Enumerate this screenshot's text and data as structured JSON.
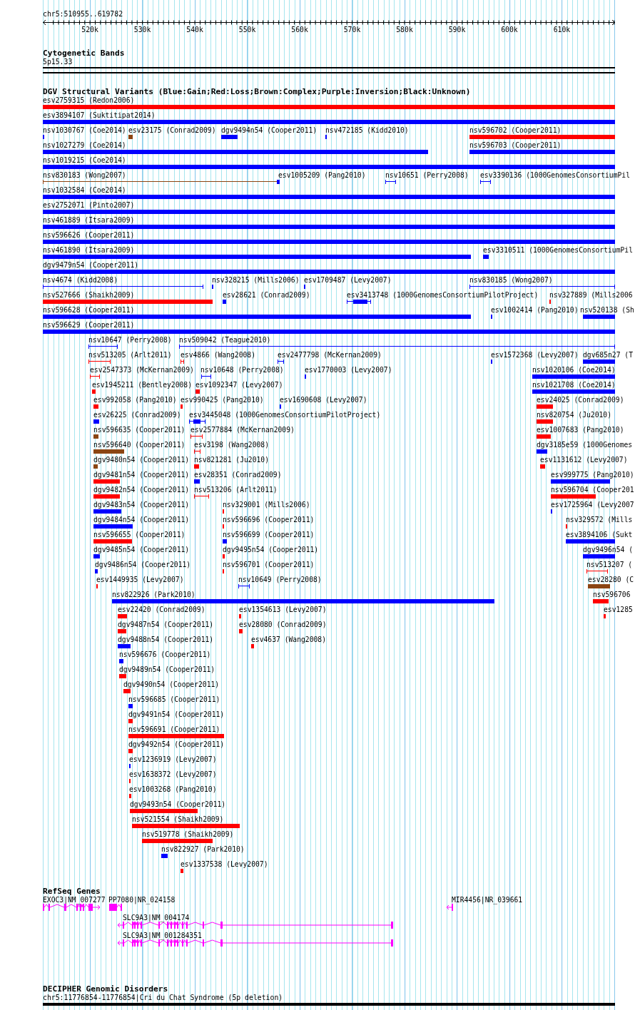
{
  "ruler": {
    "location": "chr5:510955..619782",
    "ticks": [
      "520k",
      "530k",
      "540k",
      "550k",
      "560k",
      "570k",
      "580k",
      "590k",
      "600k",
      "610k"
    ]
  },
  "cytogenetic_bands": {
    "title": "Cytogenetic Bands",
    "band": "5p15.33"
  },
  "dgv": {
    "title": "DGV Structural Variants (Blue:Gain;Red:Loss;Brown:Complex;Purple:Inversion;Black:Unknown)",
    "rows": [
      {
        "features": [
          {
            "label": "esv2759315 (Redon2006)",
            "color": "#ff0000",
            "kind": "bar"
          }
        ]
      },
      {
        "features": [
          {
            "label": "esv3894107 (Suktitipat2014)",
            "color": "#0000ff",
            "kind": "bar"
          }
        ]
      },
      {
        "features": [
          {
            "label": "nsv1030767 (Coe2014)",
            "color": "#0000ff",
            "kind": "bar"
          },
          {
            "label": "esv23175 (Conrad2009)",
            "color": "#8b4513",
            "kind": "bar"
          },
          {
            "label": "dgv9494n54 (Cooper2011)",
            "color": "#0000ff",
            "kind": "bar"
          },
          {
            "label": "nsv472185 (Kidd2010)",
            "color": "#0000ff",
            "kind": "bar"
          },
          {
            "label": "nsv596702 (Cooper2011)",
            "color": "#ff0000",
            "kind": "bar"
          }
        ]
      },
      {
        "features": [
          {
            "label": "nsv1027279 (Coe2014)",
            "color": "#0000ff",
            "kind": "bar"
          },
          {
            "label": "nsv596703 (Cooper2011)",
            "color": "#0000ff",
            "kind": "bar"
          }
        ]
      },
      {
        "features": [
          {
            "label": "nsv1019215 (Coe2014)",
            "color": "#0000ff",
            "kind": "bar"
          }
        ]
      },
      {
        "features": [
          {
            "label": "nsv830183 (Wong2007)",
            "color": "#8b4513",
            "kind": "span"
          },
          {
            "label": "esv1005209 (Pang2010)",
            "color": "#0000ff",
            "kind": "bar"
          },
          {
            "label": "nsv10651 (Perry2008)",
            "color": "#0000ff",
            "kind": "span"
          },
          {
            "label": "esv3390136 (1000GenomesConsortiumPil",
            "color": "#0000ff",
            "kind": "span"
          }
        ]
      },
      {
        "features": [
          {
            "label": "nsv1032584 (Coe2014)",
            "color": "#0000ff",
            "kind": "bar"
          }
        ]
      },
      {
        "features": [
          {
            "label": "esv2752071 (Pinto2007)",
            "color": "#0000ff",
            "kind": "bar"
          }
        ]
      },
      {
        "features": [
          {
            "label": "nsv461889 (Itsara2009)",
            "color": "#0000ff",
            "kind": "bar"
          }
        ]
      },
      {
        "features": [
          {
            "label": "nsv596626 (Cooper2011)",
            "color": "#0000ff",
            "kind": "bar"
          }
        ]
      },
      {
        "features": [
          {
            "label": "nsv461890 (Itsara2009)",
            "color": "#0000ff",
            "kind": "bar"
          },
          {
            "label": "esv3310511 (1000GenomesConsortiumPil",
            "color": "#0000ff",
            "kind": "bar"
          }
        ]
      },
      {
        "features": [
          {
            "label": "dgv9479n54 (Cooper2011)",
            "color": "#0000ff",
            "kind": "bar"
          }
        ]
      },
      {
        "features": [
          {
            "label": "nsv4674 (Kidd2008)",
            "color": "#0000ff",
            "kind": "span"
          },
          {
            "label": "nsv328215 (Mills2006)",
            "color": "#0000ff",
            "kind": "bar"
          },
          {
            "label": "esv1709487 (Levy2007)",
            "color": "#0000ff",
            "kind": "bar"
          },
          {
            "label": "nsv830185 (Wong2007)",
            "color": "#0000ff",
            "kind": "span"
          }
        ]
      },
      {
        "features": [
          {
            "label": "nsv527666 (Shaikh2009)",
            "color": "#ff0000",
            "kind": "bar"
          },
          {
            "label": "esv28621 (Conrad2009)",
            "color": "#0000ff",
            "kind": "bar"
          },
          {
            "label": "esv3413748 (1000GenomesConsortiumPilotProject)",
            "color": "#0000ff",
            "kind": "span_core"
          },
          {
            "label": "nsv327889 (Mills2006",
            "color": "#ff0000",
            "kind": "bar"
          }
        ]
      },
      {
        "features": [
          {
            "label": "nsv596628 (Cooper2011)",
            "color": "#0000ff",
            "kind": "bar"
          },
          {
            "label": "esv1002414 (Pang2010)",
            "color": "#0000ff",
            "kind": "bar"
          },
          {
            "label": "nsv520138 (Sh",
            "color": "#0000ff",
            "kind": "bar"
          }
        ]
      },
      {
        "features": [
          {
            "label": "nsv596629 (Cooper2011)",
            "color": "#0000ff",
            "kind": "bar"
          }
        ]
      },
      {
        "features": [
          {
            "label": "nsv10647 (Perry2008)",
            "color": "#0000ff",
            "kind": "span"
          },
          {
            "label": "nsv509042 (Teague2010)",
            "color": "#0000ff",
            "kind": "span"
          }
        ]
      },
      {
        "features": [
          {
            "label": "nsv513205 (Arlt2011)",
            "color": "#ff0000",
            "kind": "span"
          },
          {
            "label": "esv4866 (Wang2008)",
            "color": "#ff0000",
            "kind": "span"
          },
          {
            "label": "esv2477798 (McKernan2009)",
            "color": "#0000ff",
            "kind": "span"
          },
          {
            "label": "esv1572368 (Levy2007)",
            "color": "#0000ff",
            "kind": "bar"
          },
          {
            "label": "dgv685n27 (T",
            "color": "#0000ff",
            "kind": "bar"
          }
        ]
      },
      {
        "features": [
          {
            "label": "esv2547373 (McKernan2009)",
            "color": "#ff0000",
            "kind": "span"
          },
          {
            "label": "nsv10648 (Perry2008)",
            "color": "#0000ff",
            "kind": "span"
          },
          {
            "label": "esv1770003 (Levy2007)",
            "color": "#0000ff",
            "kind": "bar"
          },
          {
            "label": "nsv1020106 (Coe2014)",
            "color": "#0000ff",
            "kind": "bar"
          }
        ]
      },
      {
        "features": [
          {
            "label": "esv1945211 (Bentley2008)",
            "color": "#ff0000",
            "kind": "bar"
          },
          {
            "label": "esv1092347 (Levy2007)",
            "color": "#ff0000",
            "kind": "bar"
          },
          {
            "label": "nsv1021708 (Coe2014)",
            "color": "#0000ff",
            "kind": "bar"
          }
        ]
      },
      {
        "features": [
          {
            "label": "esv992058 (Pang2010)",
            "color": "#ff0000",
            "kind": "bar"
          },
          {
            "label": "esv990425 (Pang2010)",
            "color": "#ff0000",
            "kind": "bar"
          },
          {
            "label": "esv1690608 (Levy2007)",
            "color": "#0000ff",
            "kind": "bar"
          },
          {
            "label": "esv24025 (Conrad2009)",
            "color": "#ff0000",
            "kind": "bar"
          }
        ]
      },
      {
        "features": [
          {
            "label": "esv26225 (Conrad2009)",
            "color": "#0000ff",
            "kind": "bar"
          },
          {
            "label": "esv3445048 (1000GenomesConsortiumPilotProject)",
            "color": "#0000ff",
            "kind": "span_core"
          },
          {
            "label": "nsv820754 (Ju2010)",
            "color": "#ff0000",
            "kind": "bar"
          }
        ]
      },
      {
        "features": [
          {
            "label": "nsv596635 (Cooper2011)",
            "color": "#8b4513",
            "kind": "bar"
          },
          {
            "label": "esv2577884 (McKernan2009)",
            "color": "#ff0000",
            "kind": "span"
          },
          {
            "label": "esv1007683 (Pang2010)",
            "color": "#ff0000",
            "kind": "bar"
          }
        ]
      },
      {
        "features": [
          {
            "label": "nsv596640 (Cooper2011)",
            "color": "#8b4513",
            "kind": "bar"
          },
          {
            "label": "esv3198 (Wang2008)",
            "color": "#ff0000",
            "kind": "span"
          },
          {
            "label": "dgv3185e59 (1000Genomes",
            "color": "#0000ff",
            "kind": "bar"
          }
        ]
      },
      {
        "features": [
          {
            "label": "dgv9480n54 (Cooper2011)",
            "color": "#8b4513",
            "kind": "bar"
          },
          {
            "label": "nsv821281 (Ju2010)",
            "color": "#ff0000",
            "kind": "bar"
          },
          {
            "label": "esv1131612 (Levy2007)",
            "color": "#ff0000",
            "kind": "bar"
          }
        ]
      },
      {
        "features": [
          {
            "label": "dgv9481n54 (Cooper2011)",
            "color": "#ff0000",
            "kind": "bar"
          },
          {
            "label": "esv28351 (Conrad2009)",
            "color": "#0000ff",
            "kind": "bar"
          },
          {
            "label": "esv999775 (Pang2010)",
            "color": "#0000ff",
            "kind": "bar"
          }
        ]
      },
      {
        "features": [
          {
            "label": "dgv9482n54 (Cooper2011)",
            "color": "#ff0000",
            "kind": "bar"
          },
          {
            "label": "nsv513206 (Arlt2011)",
            "color": "#ff0000",
            "kind": "span"
          },
          {
            "label": "nsv596704 (Cooper201",
            "color": "#ff0000",
            "kind": "bar"
          }
        ]
      },
      {
        "features": [
          {
            "label": "dgv9483n54 (Cooper2011)",
            "color": "#0000ff",
            "kind": "bar"
          },
          {
            "label": "nsv329001 (Mills2006)",
            "color": "#ff0000",
            "kind": "bar"
          },
          {
            "label": "esv1725964 (Levy2007",
            "color": "#0000ff",
            "kind": "bar"
          }
        ]
      },
      {
        "features": [
          {
            "label": "dgv9484n54 (Cooper2011)",
            "color": "#0000ff",
            "kind": "bar"
          },
          {
            "label": "nsv596696 (Cooper2011)",
            "color": "#ff0000",
            "kind": "bar"
          },
          {
            "label": "nsv329572 (Mills",
            "color": "#ff0000",
            "kind": "bar"
          }
        ]
      },
      {
        "features": [
          {
            "label": "nsv596655 (Cooper2011)",
            "color": "#ff0000",
            "kind": "bar"
          },
          {
            "label": "nsv596699 (Cooper2011)",
            "color": "#0000ff",
            "kind": "bar"
          },
          {
            "label": "esv3894106 (Sukt",
            "color": "#0000ff",
            "kind": "bar"
          }
        ]
      },
      {
        "features": [
          {
            "label": "dgv9485n54 (Cooper2011)",
            "color": "#0000ff",
            "kind": "bar"
          },
          {
            "label": "dgv9495n54 (Cooper2011)",
            "color": "#ff0000",
            "kind": "bar"
          },
          {
            "label": "dgv9496n54 (",
            "color": "#0000ff",
            "kind": "bar"
          }
        ]
      },
      {
        "features": [
          {
            "label": "dgv9486n54 (Cooper2011)",
            "color": "#0000ff",
            "kind": "bar"
          },
          {
            "label": "nsv596701 (Cooper2011)",
            "color": "#ff0000",
            "kind": "bar"
          },
          {
            "label": "nsv513207 (",
            "color": "#ff0000",
            "kind": "span"
          }
        ]
      },
      {
        "features": [
          {
            "label": "esv1449935 (Levy2007)",
            "color": "#ff0000",
            "kind": "bar"
          },
          {
            "label": "nsv10649 (Perry2008)",
            "color": "#0000ff",
            "kind": "span"
          },
          {
            "label": "esv28280 (C",
            "color": "#8b4513",
            "kind": "bar"
          }
        ]
      },
      {
        "features": [
          {
            "label": "nsv822926 (Park2010)",
            "color": "#0000ff",
            "kind": "bar"
          },
          {
            "label": "nsv596706",
            "color": "#ff0000",
            "kind": "bar"
          }
        ]
      },
      {
        "features": [
          {
            "label": "esv22420 (Conrad2009)",
            "color": "#ff0000",
            "kind": "bar"
          },
          {
            "label": "esv1354613 (Levy2007)",
            "color": "#ff0000",
            "kind": "bar"
          },
          {
            "label": "esv1285",
            "color": "#ff0000",
            "kind": "bar"
          }
        ]
      },
      {
        "features": [
          {
            "label": "dgv9487n54 (Cooper2011)",
            "color": "#ff0000",
            "kind": "bar"
          },
          {
            "label": "esv28080 (Conrad2009)",
            "color": "#ff0000",
            "kind": "bar"
          }
        ]
      },
      {
        "features": [
          {
            "label": "dgv9488n54 (Cooper2011)",
            "color": "#0000ff",
            "kind": "bar"
          },
          {
            "label": "esv4637 (Wang2008)",
            "color": "#ff0000",
            "kind": "bar"
          }
        ]
      },
      {
        "features": [
          {
            "label": "nsv596676 (Cooper2011)",
            "color": "#0000ff",
            "kind": "bar"
          }
        ]
      },
      {
        "features": [
          {
            "label": "dgv9489n54 (Cooper2011)",
            "color": "#ff0000",
            "kind": "bar"
          }
        ]
      },
      {
        "features": [
          {
            "label": "dgv9490n54 (Cooper2011)",
            "color": "#ff0000",
            "kind": "bar"
          }
        ]
      },
      {
        "features": [
          {
            "label": "nsv596685 (Cooper2011)",
            "color": "#0000ff",
            "kind": "bar"
          }
        ]
      },
      {
        "features": [
          {
            "label": "dgv9491n54 (Cooper2011)",
            "color": "#ff0000",
            "kind": "bar"
          }
        ]
      },
      {
        "features": [
          {
            "label": "nsv596691 (Cooper2011)",
            "color": "#ff0000",
            "kind": "bar"
          }
        ]
      },
      {
        "features": [
          {
            "label": "dgv9492n54 (Cooper2011)",
            "color": "#ff0000",
            "kind": "bar"
          }
        ]
      },
      {
        "features": [
          {
            "label": "esv1236919 (Levy2007)",
            "color": "#0000ff",
            "kind": "bar"
          }
        ]
      },
      {
        "features": [
          {
            "label": "esv1638372 (Levy2007)",
            "color": "#ff0000",
            "kind": "bar"
          }
        ]
      },
      {
        "features": [
          {
            "label": "esv1003268 (Pang2010)",
            "color": "#ff0000",
            "kind": "bar"
          }
        ]
      },
      {
        "features": [
          {
            "label": "dgv9493n54 (Cooper2011)",
            "color": "#ff0000",
            "kind": "bar"
          }
        ]
      },
      {
        "features": [
          {
            "label": "nsv521554 (Shaikh2009)",
            "color": "#ff0000",
            "kind": "bar"
          }
        ]
      },
      {
        "features": [
          {
            "label": "nsv519778 (Shaikh2009)",
            "color": "#ff0000",
            "kind": "bar"
          }
        ]
      },
      {
        "features": [
          {
            "label": "nsv822927 (Park2010)",
            "color": "#0000ff",
            "kind": "bar"
          }
        ]
      },
      {
        "features": [
          {
            "label": "esv1337538 (Levy2007)",
            "color": "#ff0000",
            "kind": "bar"
          }
        ]
      }
    ]
  },
  "refseq_genes": {
    "title": "RefSeq Genes",
    "rows": [
      {
        "genes": [
          {
            "label": "EXOC3|NM_007277",
            "reverse": false
          },
          {
            "label": "PP7080|NR_024158"
          },
          {
            "label": "MIR4456|NR_039661",
            "reverse": true
          }
        ]
      },
      {
        "genes": [
          {
            "label": "SLC9A3|NM_004174",
            "reverse": true
          }
        ]
      },
      {
        "genes": [
          {
            "label": "SLC9A3|NM_001284351",
            "reverse": true
          }
        ]
      }
    ]
  },
  "decipher": {
    "title": "DECIPHER Genomic Disorders",
    "label": "chr5:11776854-11776854|Cri du Chat Syndrome (5p deletion)"
  }
}
